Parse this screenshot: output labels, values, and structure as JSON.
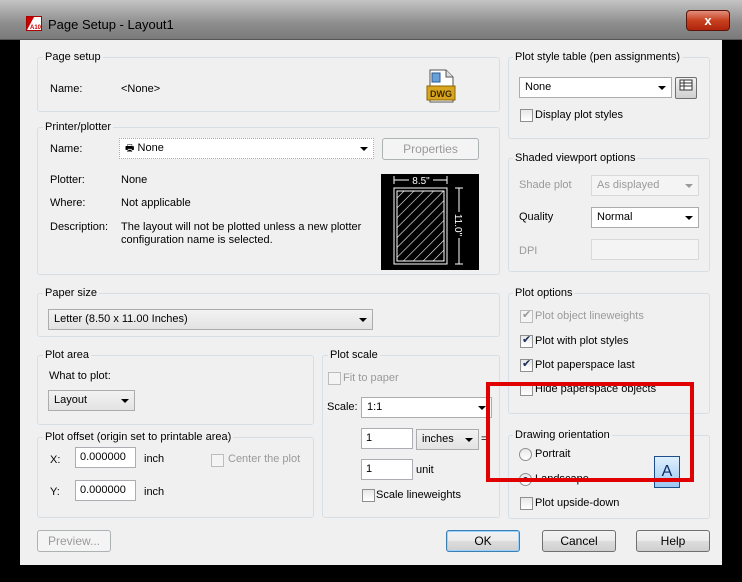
{
  "window": {
    "title": "Page Setup - Layout1",
    "close_glyph": "x"
  },
  "page_setup": {
    "group_title": "Page setup",
    "name_label": "Name:",
    "name_value": "<None>",
    "dwg_icon_text": "DWG"
  },
  "printer": {
    "group_title": "Printer/plotter",
    "name_label": "Name:",
    "name_value": "None",
    "properties_button": "Properties",
    "plotter_label": "Plotter:",
    "plotter_value": "None",
    "where_label": "Where:",
    "where_value": "Not applicable",
    "description_label": "Description:",
    "description_line1": "The layout will not be plotted unless a new plotter",
    "description_line2": "configuration name is selected.",
    "preview_width": "8.5\"",
    "preview_height": "11.0\""
  },
  "paper_size": {
    "group_title": "Paper size",
    "value": "Letter (8.50 x 11.00 Inches)"
  },
  "plot_area": {
    "group_title": "Plot area",
    "what_label": "What to plot:",
    "what_value": "Layout"
  },
  "plot_offset": {
    "group_title": "Plot offset (origin set to printable area)",
    "x_label": "X:",
    "x_value": "0.000000",
    "x_unit": "inch",
    "y_label": "Y:",
    "y_value": "0.000000",
    "y_unit": "inch",
    "center_label": "Center the plot"
  },
  "plot_scale": {
    "group_title": "Plot scale",
    "fit_label": "Fit to paper",
    "scale_label": "Scale:",
    "scale_value": "1:1",
    "value1": "1",
    "unit1": "inches",
    "equals": "=",
    "value2": "1",
    "unit2": "unit",
    "lineweights_label": "Scale lineweights"
  },
  "plot_style_table": {
    "group_title": "Plot style table (pen assignments)",
    "value": "None",
    "display_label": "Display plot styles"
  },
  "shaded_viewport": {
    "group_title": "Shaded viewport options",
    "shade_label": "Shade plot",
    "shade_value": "As displayed",
    "quality_label": "Quality",
    "quality_value": "Normal",
    "dpi_label": "DPI",
    "dpi_value": ""
  },
  "plot_options": {
    "group_title": "Plot options",
    "items": [
      {
        "label": "Plot object lineweights",
        "checked": true,
        "disabled": true
      },
      {
        "label": "Plot with plot styles",
        "checked": true,
        "disabled": false
      },
      {
        "label": "Plot paperspace last",
        "checked": true,
        "disabled": false
      },
      {
        "label": "Hide paperspace objects",
        "checked": false,
        "disabled": false
      }
    ]
  },
  "drawing_orientation": {
    "group_title": "Drawing orientation",
    "portrait": "Portrait",
    "landscape": "Landscape",
    "upside_down": "Plot upside-down",
    "selected": "landscape",
    "icon_letter": "A"
  },
  "buttons": {
    "preview": "Preview...",
    "ok": "OK",
    "cancel": "Cancel",
    "help": "Help"
  },
  "colors": {
    "highlight": "#e00000",
    "client_bg": "#f0f0f0"
  }
}
